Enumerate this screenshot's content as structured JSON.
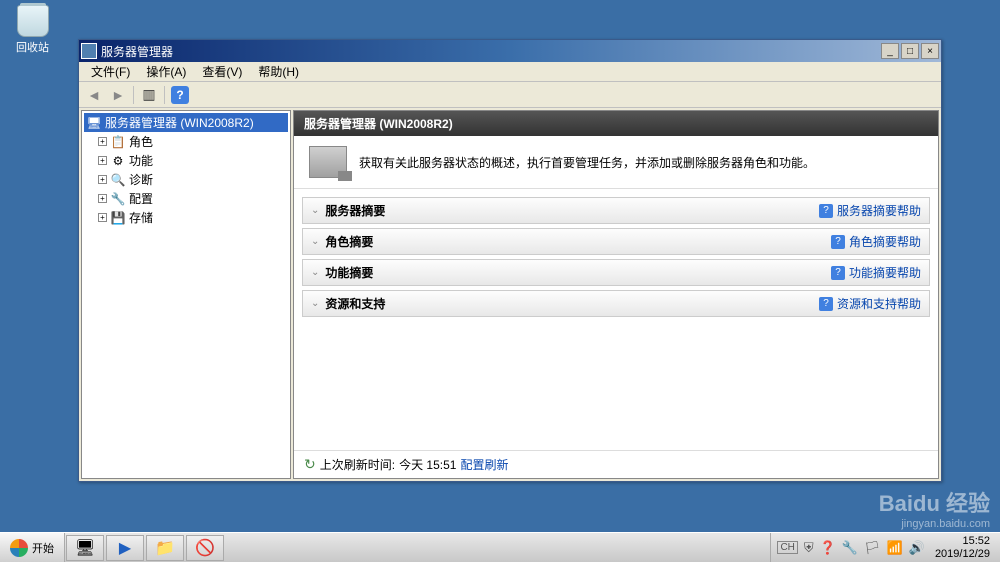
{
  "desktop": {
    "recycle_bin": "回收站"
  },
  "window": {
    "title": "服务器管理器",
    "menu": {
      "file": "文件(F)",
      "action": "操作(A)",
      "view": "查看(V)",
      "help": "帮助(H)"
    },
    "tree": {
      "root": "服务器管理器 (WIN2008R2)",
      "items": [
        {
          "label": "角色",
          "icon": "📋"
        },
        {
          "label": "功能",
          "icon": "⚙"
        },
        {
          "label": "诊断",
          "icon": "🔍"
        },
        {
          "label": "配置",
          "icon": "🔧"
        },
        {
          "label": "存储",
          "icon": "💾"
        }
      ]
    },
    "main": {
      "header": "服务器管理器 (WIN2008R2)",
      "intro": "获取有关此服务器状态的概述，执行首要管理任务，并添加或删除服务器角色和功能。",
      "sections": [
        {
          "title": "服务器摘要",
          "help": "服务器摘要帮助"
        },
        {
          "title": "角色摘要",
          "help": "角色摘要帮助"
        },
        {
          "title": "功能摘要",
          "help": "功能摘要帮助"
        },
        {
          "title": "资源和支持",
          "help": "资源和支持帮助"
        }
      ],
      "footer_label": "上次刷新时间:",
      "footer_time": "今天 15:51",
      "footer_link": "配置刷新"
    }
  },
  "taskbar": {
    "start": "开始",
    "lang": "CH",
    "time": "15:52",
    "date": "2019/12/29"
  },
  "watermark": {
    "main": "Baidu 经验",
    "sub": "jingyan.baidu.com"
  }
}
